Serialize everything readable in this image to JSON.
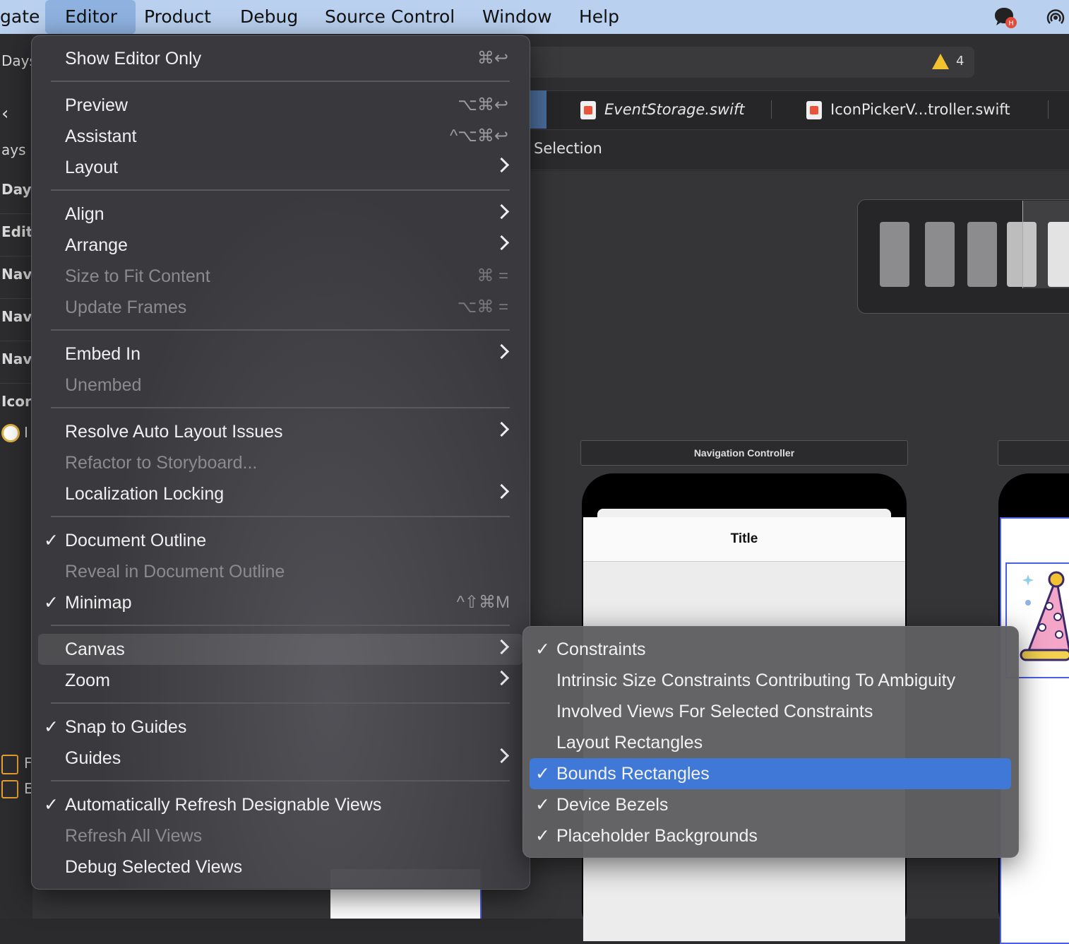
{
  "menubar": {
    "items": [
      "gate",
      "Editor",
      "Product",
      "Debug",
      "Source Control",
      "Window",
      "Help"
    ],
    "active": "Editor"
  },
  "sidebar": {
    "labels": [
      "Days",
      "ays",
      "Day",
      "Edit",
      "Nav",
      "Nav",
      "Nav",
      "Icor",
      "I",
      "F",
      "E"
    ]
  },
  "toolbar": {
    "warning_count": "4"
  },
  "tabs": [
    {
      "label": "EventStorage.swift"
    },
    {
      "label": "IconPickerV...troller.swift"
    }
  ],
  "jumpbar": {
    "text": "Selection"
  },
  "canvas": {
    "scene_label": "Navigation Controller",
    "nav_title": "Title"
  },
  "editor_menu": {
    "items": [
      {
        "label": "Show Editor Only",
        "shortcut": "⌘↩",
        "enabled": true
      },
      {
        "label": "Preview",
        "shortcut": "⌥⌘↩",
        "enabled": true
      },
      {
        "label": "Assistant",
        "shortcut": "^⌥⌘↩",
        "enabled": true
      },
      {
        "label": "Layout",
        "submenu": true,
        "enabled": true
      },
      {
        "label": "Align",
        "submenu": true,
        "enabled": true
      },
      {
        "label": "Arrange",
        "submenu": true,
        "enabled": true
      },
      {
        "label": "Size to Fit Content",
        "shortcut": "⌘ =",
        "enabled": false
      },
      {
        "label": "Update Frames",
        "shortcut": "⌥⌘ =",
        "enabled": false
      },
      {
        "label": "Embed In",
        "submenu": true,
        "enabled": true
      },
      {
        "label": "Unembed",
        "enabled": false
      },
      {
        "label": "Resolve Auto Layout Issues",
        "submenu": true,
        "enabled": true
      },
      {
        "label": "Refactor to Storyboard...",
        "enabled": false
      },
      {
        "label": "Localization Locking",
        "submenu": true,
        "enabled": true
      },
      {
        "label": "Document Outline",
        "checked": true,
        "enabled": true
      },
      {
        "label": "Reveal in Document Outline",
        "enabled": false
      },
      {
        "label": "Minimap",
        "checked": true,
        "shortcut": "^⇧⌘M",
        "enabled": true
      },
      {
        "label": "Canvas",
        "submenu": true,
        "highlighted": true,
        "enabled": true
      },
      {
        "label": "Zoom",
        "submenu": true,
        "enabled": true
      },
      {
        "label": "Snap to Guides",
        "checked": true,
        "enabled": true
      },
      {
        "label": "Guides",
        "submenu": true,
        "enabled": true
      },
      {
        "label": "Automatically Refresh Designable Views",
        "checked": true,
        "enabled": true
      },
      {
        "label": "Refresh All Views",
        "enabled": false
      },
      {
        "label": "Debug Selected Views",
        "enabled": true
      }
    ]
  },
  "canvas_submenu": {
    "items": [
      {
        "label": "Constraints",
        "checked": true
      },
      {
        "label": "Intrinsic Size Constraints Contributing To Ambiguity",
        "checked": false
      },
      {
        "label": "Involved Views For Selected Constraints",
        "checked": false
      },
      {
        "label": "Layout Rectangles",
        "checked": false
      },
      {
        "label": "Bounds Rectangles",
        "checked": true,
        "selected": true
      },
      {
        "label": "Device Bezels",
        "checked": true
      },
      {
        "label": "Placeholder Backgrounds",
        "checked": true
      }
    ]
  },
  "icons": {
    "checkmark": "✓",
    "menubar_right": [
      "chat-notification-icon",
      "airdrop-icon"
    ]
  },
  "colors": {
    "menubar_bg": "#b9d0ee",
    "selection": "#3f78d6",
    "warning": "#f2c230"
  }
}
